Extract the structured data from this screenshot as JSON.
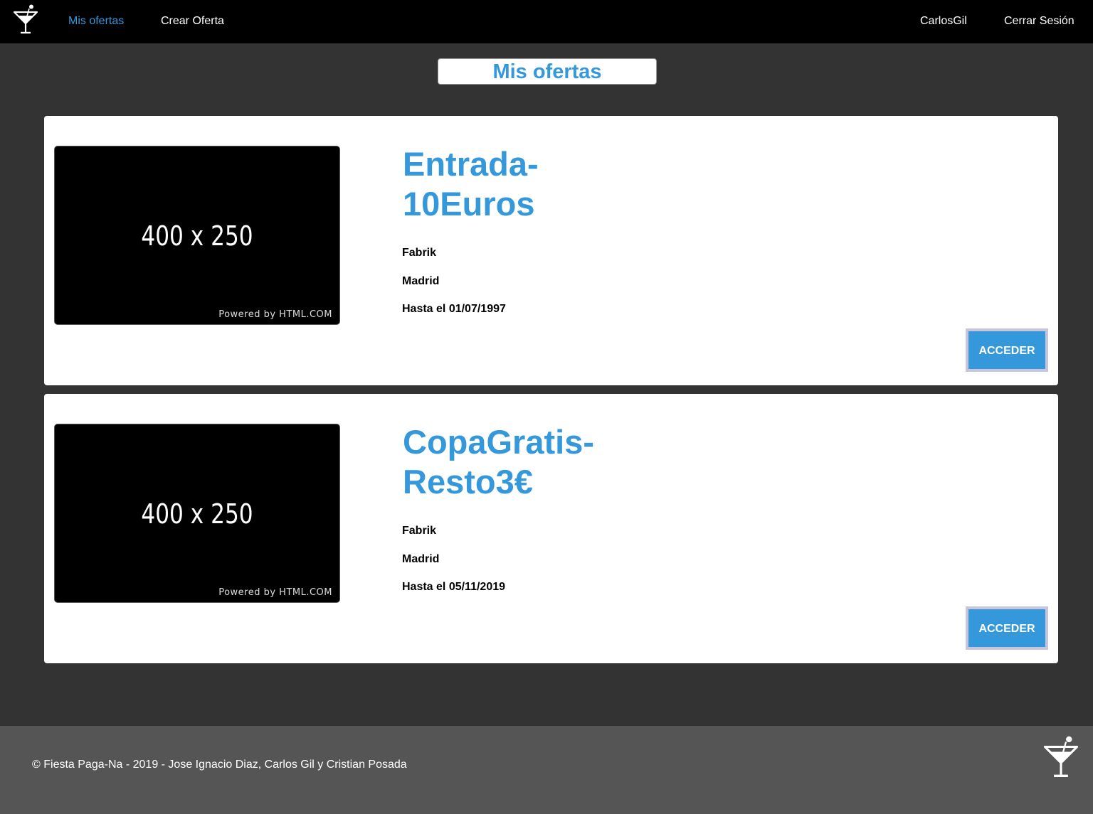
{
  "nav": {
    "logo_icon": "cocktail-glass-icon",
    "links": [
      "Mis ofertas",
      "Crear Oferta"
    ],
    "active_link": "Mis ofertas",
    "user": "CarlosGil",
    "logout": "Cerrar Sesión"
  },
  "page_title": "Mis ofertas",
  "offers": [
    {
      "image_size_text": "400 x 250",
      "image_powered_text": "Powered by HTML.COM",
      "title": "Entrada-10Euros",
      "local": "Fabrik",
      "city": "Madrid",
      "until": "Hasta el 01/07/1997",
      "button": "ACCEDER"
    },
    {
      "image_size_text": "400 x 250",
      "image_powered_text": "Powered by HTML.COM",
      "title": "CopaGratis-Resto3€",
      "local": "Fabrik",
      "city": "Madrid",
      "until": "Hasta el 05/11/2019",
      "button": "ACCEDER"
    }
  ],
  "footer": {
    "text": "© Fiesta Paga-Na - 2019 - Jose Ignacio Diaz, Carlos Gil y Cristian Posada",
    "logo_icon": "cocktail-glass-icon"
  },
  "colors": {
    "accent": "#3498db",
    "navbar_bg": "#000000",
    "page_bg": "#333333",
    "footer_bg": "#555555",
    "card_bg": "#ffffff",
    "button_border": "#c6c6dc"
  }
}
